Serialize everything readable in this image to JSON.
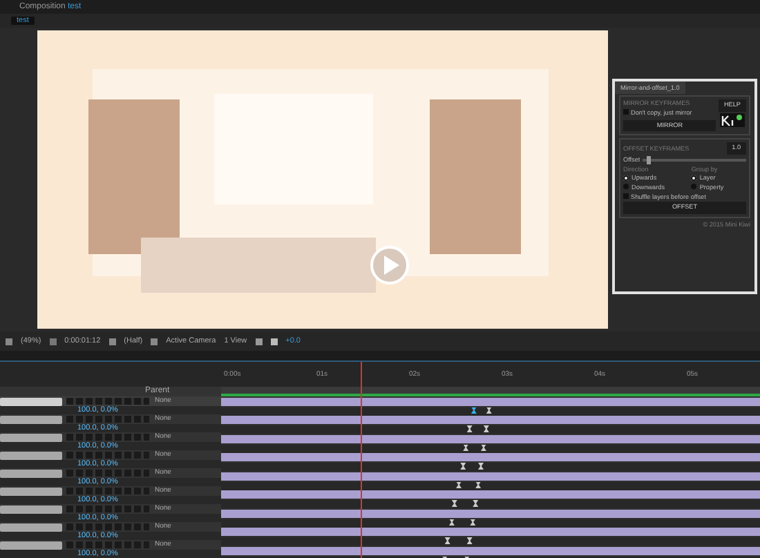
{
  "tab": {
    "title": "Composition",
    "name": "test"
  },
  "viewer_tab": {
    "label": "test",
    "selected": true
  },
  "panel": {
    "tab": "Mirror-and-offset_1.0",
    "mirror_section": "MIRROR KEYFRAMES",
    "dont_copy": {
      "label": "Don't copy, just mirror",
      "checked": false
    },
    "help": "HELP",
    "mirror": "MIRROR",
    "offset_section": "OFFSET KEYFRAMES",
    "offset_value": "1.0",
    "offset_label": "Offset",
    "offset": {
      "level": 0.04
    },
    "direction_label": "Direction",
    "direction": [
      {
        "label": "Upwards",
        "selected": true
      },
      {
        "label": "Downwards",
        "selected": false
      }
    ],
    "group_label": "Group by",
    "group": [
      {
        "label": "Layer",
        "selected": true
      },
      {
        "label": "Property",
        "selected": false
      }
    ],
    "shuffle": {
      "label": "Shuffle layers before offset",
      "checked": false
    },
    "offset_button": "OFFSET",
    "footer": "© 2015 Mini Kiwi"
  },
  "viewer_toolbar": {
    "zoom": "(49%)",
    "timecode": "0:00:01:12",
    "resolution": "(Half)",
    "camera": "Active Camera",
    "views": "1 View",
    "exposure": "+0.0"
  },
  "timeline": {
    "ruler": [
      "0:00s",
      "01s",
      "02s",
      "03s",
      "04s",
      "05s"
    ],
    "playhead": {
      "level": 0.26
    },
    "parent_header": "Parent",
    "rows": [
      {
        "parent": "None",
        "value": "100.0, 0.0%",
        "selected": true,
        "keyframes": [
          {
            "level": 0.464
          },
          {
            "level": 0.492
          }
        ]
      },
      {
        "parent": "None",
        "value": "100.0, 0.0%",
        "selected": false,
        "keyframes": [
          {
            "level": 0.456
          },
          {
            "level": 0.487
          }
        ]
      },
      {
        "parent": "None",
        "value": "100.0, 0.0%",
        "selected": false,
        "keyframes": [
          {
            "level": 0.449
          },
          {
            "level": 0.482
          }
        ]
      },
      {
        "parent": "None",
        "value": "100.0, 0.0%",
        "selected": false,
        "keyframes": [
          {
            "level": 0.444
          },
          {
            "level": 0.477
          }
        ]
      },
      {
        "parent": "None",
        "value": "100.0, 0.0%",
        "selected": false,
        "keyframes": [
          {
            "level": 0.436
          },
          {
            "level": 0.472
          }
        ]
      },
      {
        "parent": "None",
        "value": "100.0, 0.0%",
        "selected": false,
        "keyframes": [
          {
            "level": 0.428
          },
          {
            "level": 0.467
          }
        ]
      },
      {
        "parent": "None",
        "value": "100.0, 0.0%",
        "selected": false,
        "keyframes": [
          {
            "level": 0.423
          },
          {
            "level": 0.462
          }
        ]
      },
      {
        "parent": "None",
        "value": "100.0, 0.0%",
        "selected": false,
        "keyframes": [
          {
            "level": 0.415
          },
          {
            "level": 0.456
          }
        ]
      },
      {
        "parent": "None",
        "value": "100.0, 0.0%",
        "selected": false,
        "keyframes": [
          {
            "level": 0.41
          },
          {
            "level": 0.451
          }
        ]
      }
    ]
  }
}
